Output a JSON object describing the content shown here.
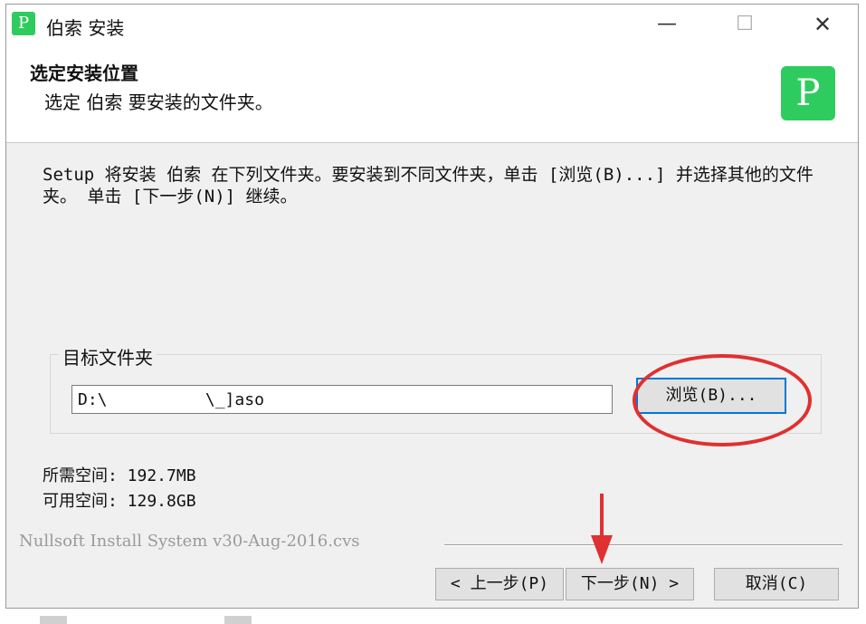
{
  "window": {
    "title": "伯索 安装",
    "app_icon_glyph": "P",
    "min_glyph": "—",
    "max_glyph": "☐",
    "close_glyph": "✕"
  },
  "header": {
    "title": "选定安装位置",
    "subtitle": "选定 伯索 要安装的文件夹。",
    "logo_glyph": "P"
  },
  "description": "Setup 将安装 伯索 在下列文件夹。要安装到不同文件夹，单击 [浏览(B)...] 并选择其他的文件夹。 单击 [下一步(N)] 继续。",
  "target_folder": {
    "label": "目标文件夹",
    "path_value": "D:\\          \\_]aso",
    "browse_label": "浏览(B)..."
  },
  "space": {
    "required": "所需空间: 192.7MB",
    "available": "可用空间: 129.8GB"
  },
  "branding": "Nullsoft Install System v30-Aug-2016.cvs",
  "buttons": {
    "back": "< 上一步(P)",
    "next": "下一步(N) >",
    "cancel": "取消(C)"
  },
  "colors": {
    "accent": "#2ecc5e",
    "focus": "#0078d7",
    "highlight": "#e03030"
  }
}
